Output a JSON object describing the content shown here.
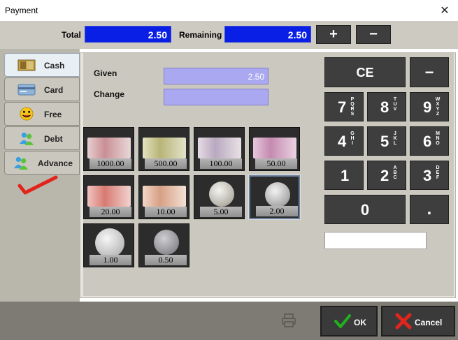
{
  "window": {
    "title": "Payment",
    "close_glyph": "✕"
  },
  "summary": {
    "total_label": "Total",
    "total_value": "2.50",
    "remaining_label": "Remaining",
    "remaining_value": "2.50",
    "plus_label": "+",
    "minus_label": "−"
  },
  "tabs": [
    {
      "label": "Cash",
      "icon": "cash-icon"
    },
    {
      "label": "Card",
      "icon": "card-icon"
    },
    {
      "label": "Free",
      "icon": "free-icon"
    },
    {
      "label": "Debt",
      "icon": "debt-icon"
    },
    {
      "label": "Advance",
      "icon": "advance-icon"
    }
  ],
  "fields": {
    "given_label": "Given",
    "given_value": "2.50",
    "change_label": "Change",
    "change_value": ""
  },
  "denominations": [
    "1000.00",
    "500.00",
    "100.00",
    "50.00",
    "20.00",
    "10.00",
    "5.00",
    "2.00",
    "1.00",
    "0.50"
  ],
  "keypad": {
    "ce": "CE",
    "backspace": "−",
    "dot": ".",
    "digits": [
      {
        "d": "7",
        "letters": "PQRS"
      },
      {
        "d": "8",
        "letters": "TUV"
      },
      {
        "d": "9",
        "letters": "WXYZ"
      },
      {
        "d": "4",
        "letters": "GHI"
      },
      {
        "d": "5",
        "letters": "JKL"
      },
      {
        "d": "6",
        "letters": "MNO"
      },
      {
        "d": "1",
        "letters": ""
      },
      {
        "d": "2",
        "letters": "ABC"
      },
      {
        "d": "3",
        "letters": "DEF"
      },
      {
        "d": "0",
        "letters": ""
      }
    ]
  },
  "footer": {
    "ok_label": "OK",
    "cancel_label": "Cancel"
  },
  "colors": {
    "value_box": "#0a1fe6",
    "given_box": "#a9a8f0",
    "key": "#3e3e3e",
    "ok_check": "#21b11e",
    "cancel_x": "#e0251c"
  }
}
